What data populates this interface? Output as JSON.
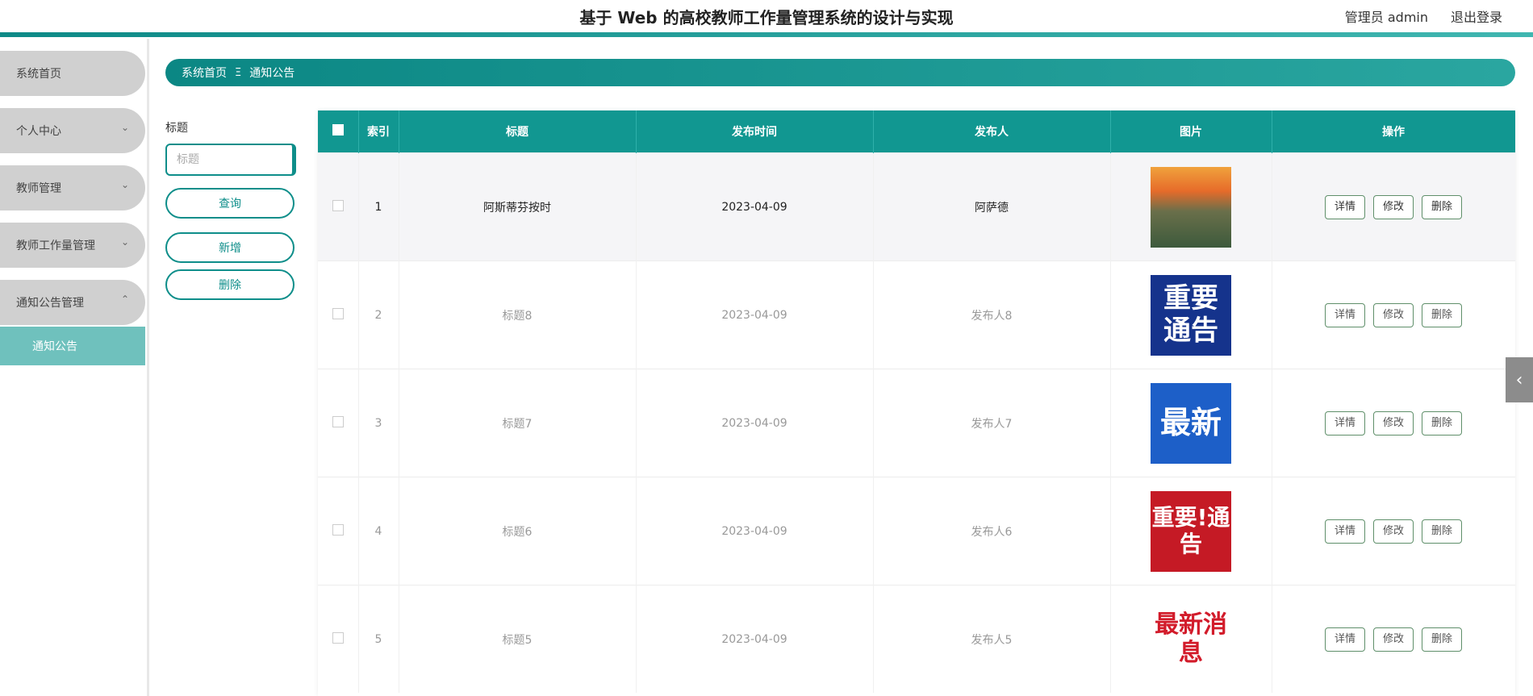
{
  "header": {
    "title": "基于 Web 的高校教师工作量管理系统的设计与实现",
    "user": "管理员 admin",
    "logout": "退出登录"
  },
  "sidebar": {
    "items": [
      {
        "label": "系统首页"
      },
      {
        "label": "个人中心"
      },
      {
        "label": "教师管理"
      },
      {
        "label": "教师工作量管理"
      },
      {
        "label": "通知公告管理"
      }
    ],
    "sub_item": "通知公告",
    "chevron_down": "⌄",
    "chevron_up": "⌃"
  },
  "breadcrumb": {
    "home": "系统首页",
    "separator": "Ξ",
    "current": "通知公告"
  },
  "search": {
    "label": "标题",
    "placeholder": "标题",
    "query_button": "查询",
    "add_button": "新增",
    "delete_button": "删除"
  },
  "table": {
    "columns": [
      "索引",
      "标题",
      "发布时间",
      "发布人",
      "图片",
      "操作"
    ],
    "rows": [
      {
        "index": "1",
        "title": "阿斯蒂芬按时",
        "date": "2023-04-09",
        "publisher": "阿萨德",
        "image_text": "",
        "image_kind": "building-photo"
      },
      {
        "index": "2",
        "title": "标题8",
        "date": "2023-04-09",
        "publisher": "发布人8",
        "image_text": "重要通告",
        "image_kind": "notice-blue"
      },
      {
        "index": "3",
        "title": "标题7",
        "date": "2023-04-09",
        "publisher": "发布人7",
        "image_text": "最新",
        "image_kind": "news-blue"
      },
      {
        "index": "4",
        "title": "标题6",
        "date": "2023-04-09",
        "publisher": "发布人6",
        "image_text": "重要!通告",
        "image_kind": "notice-red"
      },
      {
        "index": "5",
        "title": "标题5",
        "date": "2023-04-09",
        "publisher": "发布人5",
        "image_text": "最新消息",
        "image_kind": "news-red"
      }
    ],
    "actions": {
      "detail": "详情",
      "edit": "修改",
      "delete": "删除"
    }
  },
  "collapse_handle": "‹",
  "colors": {
    "accent": "#119791",
    "sidebar_active": "#6fc1bd",
    "menu_bg": "#d0d0d0"
  }
}
